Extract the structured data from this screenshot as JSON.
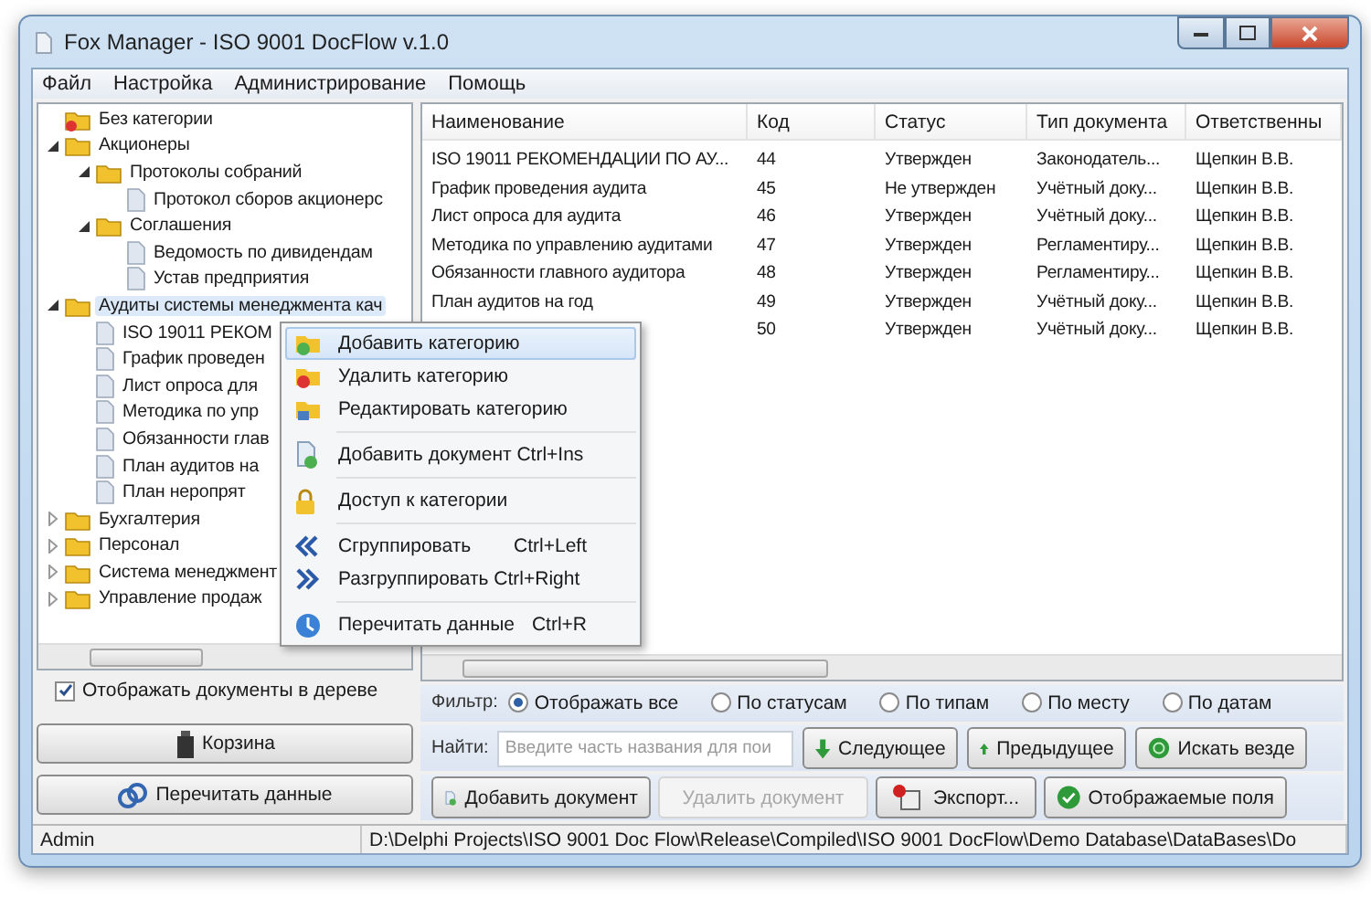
{
  "window": {
    "title": "Fox Manager - ISO 9001 DocFlow v.1.0"
  },
  "menu": [
    "Файл",
    "Настройка",
    "Администрирование",
    "Помощь"
  ],
  "tree": [
    {
      "label": "Без категории",
      "kind": "folder-none",
      "selected": false
    },
    {
      "label": "Акционеры",
      "kind": "folder",
      "expanded": true,
      "selected": false,
      "children": [
        {
          "label": "Протоколы собраний",
          "kind": "folder",
          "expanded": true,
          "selected": false,
          "children": [
            {
              "label": "Протокол сборов акционерс",
              "kind": "document",
              "selected": false
            }
          ]
        },
        {
          "label": "Соглашения",
          "kind": "folder",
          "expanded": true,
          "selected": false,
          "children": [
            {
              "label": "Ведомость по дивидендам",
              "kind": "document",
              "selected": false
            },
            {
              "label": "Устав предприятия",
              "kind": "document",
              "selected": false
            }
          ]
        }
      ]
    },
    {
      "label": "Аудиты системы менеджмента кач",
      "kind": "folder",
      "expanded": true,
      "selected": true,
      "children": [
        {
          "label": "ISO 19011 РЕКОМ",
          "kind": "document",
          "selected": false
        },
        {
          "label": "График проведен",
          "kind": "document",
          "selected": false
        },
        {
          "label": "Лист опроса для",
          "kind": "document",
          "selected": false
        },
        {
          "label": "Методика по упр",
          "kind": "document",
          "selected": false
        },
        {
          "label": "Обязанности глав",
          "kind": "document",
          "selected": false
        },
        {
          "label": "План аудитов на",
          "kind": "document",
          "selected": false
        },
        {
          "label": "План неропрят",
          "kind": "document",
          "selected": false
        }
      ]
    },
    {
      "label": "Бухгалтерия",
      "kind": "folder",
      "expanded": false,
      "selected": false
    },
    {
      "label": "Персонал",
      "kind": "folder",
      "expanded": false,
      "selected": false
    },
    {
      "label": "Система менеджмент",
      "kind": "folder",
      "expanded": false,
      "selected": false
    },
    {
      "label": "Управление продаж",
      "kind": "folder",
      "expanded": false,
      "selected": false
    }
  ],
  "show_docs_in_tree": {
    "label": "Отображать документы в дереве",
    "checked": true
  },
  "left_buttons": [
    "Корзина",
    "Перечитать данные"
  ],
  "table": {
    "columns": [
      "Наименование",
      "Код",
      "Статус",
      "Тип документа",
      "Ответственны"
    ],
    "rows": [
      {
        "cells": [
          "ISO 19011 РЕКОМЕНДАЦИИ ПО АУ...",
          "44",
          "Утвержден",
          "Законодатель...",
          "Щепкин В.В."
        ]
      },
      {
        "cells": [
          "График проведения аудита",
          "45",
          "Не утвержден",
          "Учётный доку...",
          "Щепкин В.В."
        ]
      },
      {
        "cells": [
          "Лист опроса для аудита",
          "46",
          "Утвержден",
          "Учётный доку...",
          "Щепкин В.В."
        ]
      },
      {
        "cells": [
          "Методика по управлению аудитами",
          "47",
          "Утвержден",
          "Регламентиру...",
          "Щепкин В.В."
        ]
      },
      {
        "cells": [
          "Обязанности главного аудитора",
          "48",
          "Утвержден",
          "Регламентиру...",
          "Щепкин В.В."
        ]
      },
      {
        "cells": [
          "План аудитов на год",
          "49",
          "Утвержден",
          "Учётный доку...",
          "Щепкин В.В."
        ]
      },
      {
        "cells": [
          null,
          "50",
          "Утвержден",
          "Учётный доку...",
          "Щепкин В.В."
        ]
      }
    ]
  },
  "filter": {
    "label": "Фильтр:",
    "options": [
      {
        "label": "Отображать все",
        "selected": true
      },
      {
        "label": "По статусам",
        "selected": false
      },
      {
        "label": "По типам",
        "selected": false
      },
      {
        "label": "По месту",
        "selected": false
      },
      {
        "label": "По датам",
        "selected": false
      }
    ]
  },
  "find": {
    "label": "Найти:",
    "placeholder": "Введите часть названия для пои",
    "buttons": [
      "Следующее",
      "Предыдущее",
      "Искать везде"
    ]
  },
  "actions": [
    {
      "label": "Добавить документ",
      "disabled": false
    },
    {
      "label": "Удалить документ",
      "disabled": true
    },
    {
      "label": "Экспорт...",
      "disabled": false
    },
    {
      "label": "Отображаемые поля",
      "disabled": false
    }
  ],
  "status_bar": [
    "Admin",
    "D:\\Delphi Projects\\ISO 9001 Doc Flow\\Release\\Compiled\\ISO 9001 DocFlow\\Demo Database\\DataBases\\Do"
  ],
  "context_menu": [
    {
      "kind": "item",
      "label": "Добавить категорию",
      "selected": true
    },
    {
      "kind": "item",
      "label": "Удалить категорию",
      "selected": false
    },
    {
      "kind": "item",
      "label": "Редактировать категорию",
      "selected": false
    },
    {
      "kind": "separator"
    },
    {
      "kind": "item",
      "label": "Добавить документ Ctrl+Ins",
      "selected": false
    },
    {
      "kind": "separator"
    },
    {
      "kind": "item",
      "label": "Доступ к категории",
      "selected": false
    },
    {
      "kind": "separator"
    },
    {
      "kind": "item",
      "label": "Сгруппировать",
      "shortcut": "Ctrl+Left",
      "selected": false
    },
    {
      "kind": "item",
      "label": "Разгруппировать Ctrl+Right",
      "selected": false
    },
    {
      "kind": "separator"
    },
    {
      "kind": "item",
      "label": "Перечитать данные",
      "shortcut": "Ctrl+R",
      "selected": false
    }
  ]
}
